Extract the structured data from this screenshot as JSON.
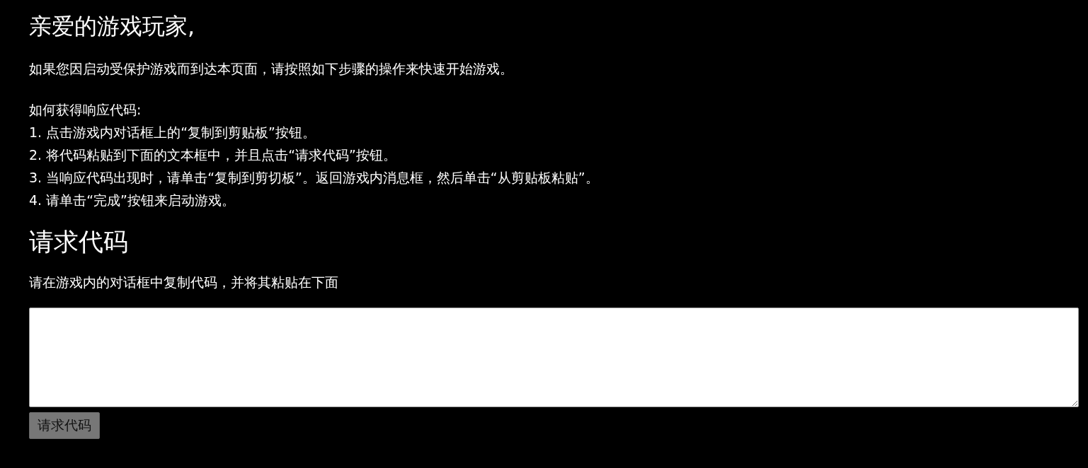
{
  "greeting": "亲爱的游戏玩家,",
  "intro": "如果您因启动受保护游戏而到达本页面，请按照如下步骤的操作来快速开始游戏。",
  "instructions": {
    "title": "如何获得响应代码:",
    "steps": [
      "1. 点击游戏内对话框上的“复制到剪贴板”按钮。",
      "2. 将代码粘贴到下面的文本框中，并且点击“请求代码”按钮。",
      "3. 当响应代码出现时，请单击“复制到剪切板”。返回游戏内消息框，然后单击“从剪贴板粘贴”。",
      "4. 请单击“完成”按钮来启动游戏。"
    ]
  },
  "request_section": {
    "title": "请求代码",
    "description": "请在游戏内的对话框中复制代码，并将其粘贴在下面",
    "button": "请求代码"
  }
}
